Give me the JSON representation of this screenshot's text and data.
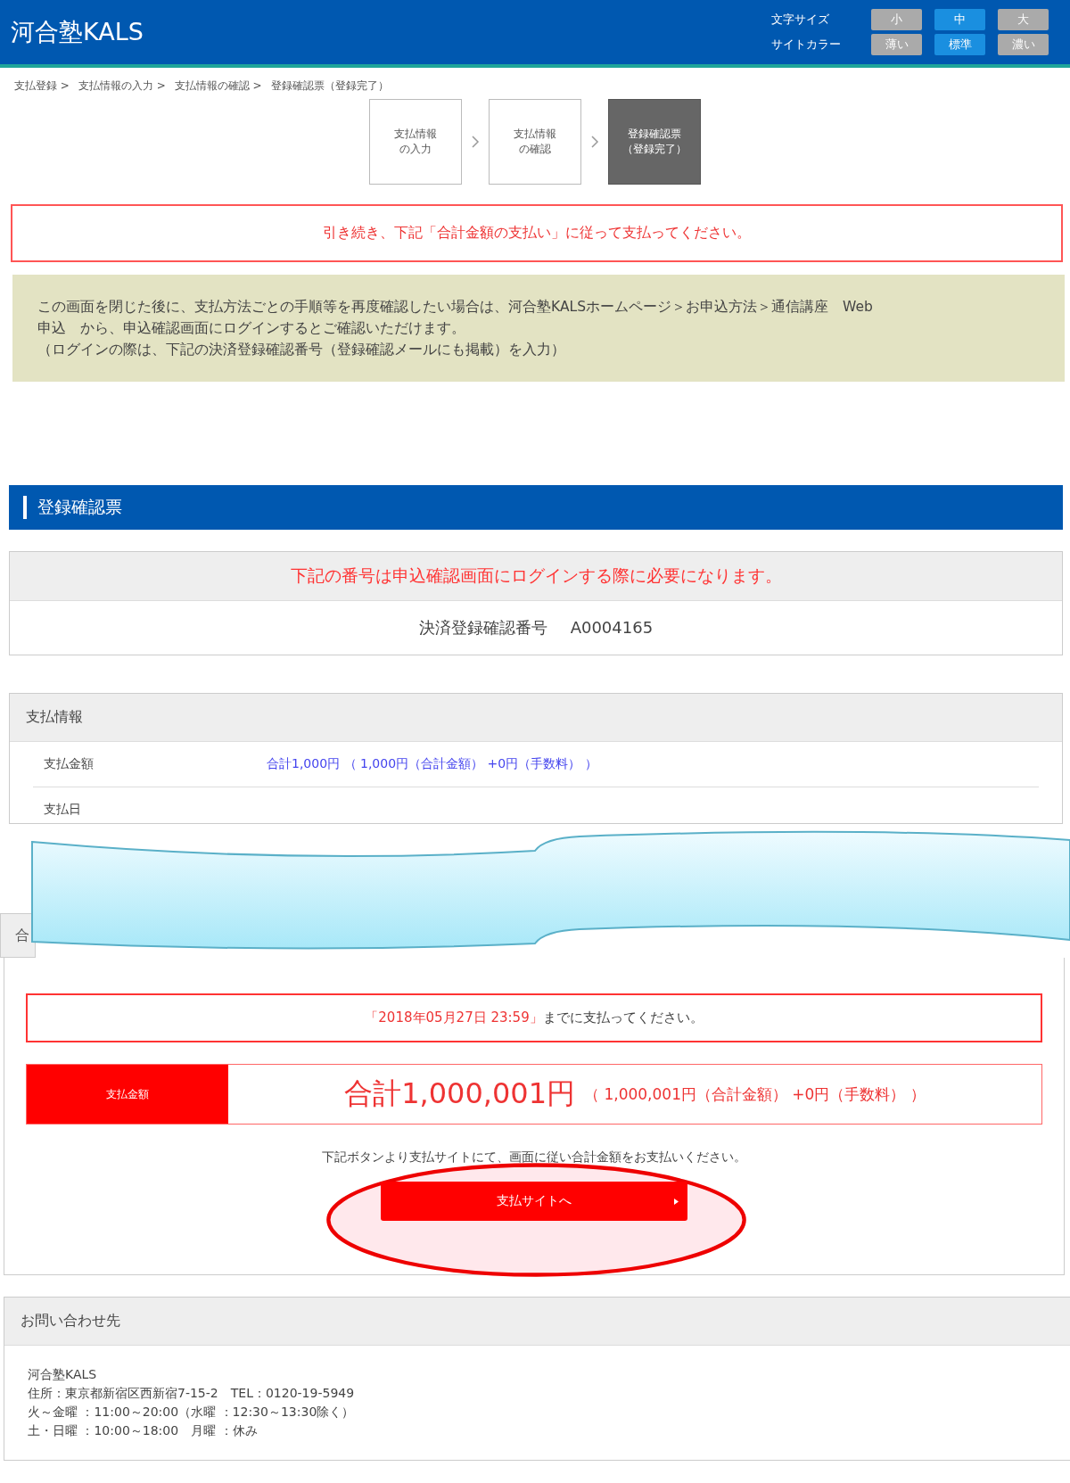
{
  "header": {
    "logo": "河合塾KALS",
    "font_size": {
      "label": "文字サイズ",
      "options": [
        {
          "label": "小",
          "selected": false
        },
        {
          "label": "中",
          "selected": true
        },
        {
          "label": "大",
          "selected": false
        }
      ]
    },
    "site_color": {
      "label": "サイトカラー",
      "options": [
        {
          "label": "薄い",
          "selected": false
        },
        {
          "label": "標準",
          "selected": true
        },
        {
          "label": "濃い",
          "selected": false
        }
      ]
    }
  },
  "breadcrumb": [
    "支払登録 >",
    "支払情報の入力 >",
    "支払情報の確認 >",
    "登録確認票（登録完了）"
  ],
  "steps": [
    {
      "lines": [
        "支払情報",
        "の入力"
      ],
      "selected": false
    },
    {
      "lines": [
        "支払情報",
        "の確認"
      ],
      "selected": false
    },
    {
      "lines": [
        "登録確認票",
        "（登録完了）"
      ],
      "selected": true
    }
  ],
  "notice": "引き続き、下記「合計金額の支払い」に従って支払ってください。",
  "info_box": [
    "この画面を閉じた後に、支払方法ごとの手順等を再度確認したい場合は、河合塾KALSホームページ＞お申込方法＞通信講座　Web\n申込　から、申込確認画面にログインするとご確認いただけます。",
    "（ログインの際は、下記の決済登録確認番号（登録確認メールにも掲載）を入力）"
  ],
  "section_title": "登録確認票",
  "confirmation": {
    "notice": "下記の番号は申込確認画面にログインする際に必要になります。",
    "label": "決済登録確認番号",
    "number": "A0004165"
  },
  "payment_info": {
    "title": "支払情報",
    "rows": [
      {
        "label": "支払金額",
        "value": "合計1,000円 （ 1,000円（合計金額） +0円（手数料） ）"
      },
      {
        "label": "支払日"
      }
    ]
  },
  "payment": {
    "header_fragment": "合",
    "deadline": {
      "date": "「2018年05月27日 23:59」",
      "rest": "までに支払ってください。"
    },
    "amount": {
      "label": "支払金額",
      "total": "合計1,000,001円",
      "breakdown": "（ 1,000,001円（合計金額） +0円（手数料） ）"
    },
    "instruction": "下記ボタンより支払サイトにて、画面に従い合計金額をお支払いください。",
    "button": "支払サイトへ"
  },
  "contact": {
    "title": "お問い合わせ先",
    "lines": [
      "河合塾KALS",
      "住所：東京都新宿区西新宿7-15-2　TEL：0120-19-5949",
      "火～金曜 ：11:00～20:00（水曜 ：12:30～13:30除く）",
      "土・日曜 ：10:00～18:00　月曜 ：休み"
    ]
  }
}
